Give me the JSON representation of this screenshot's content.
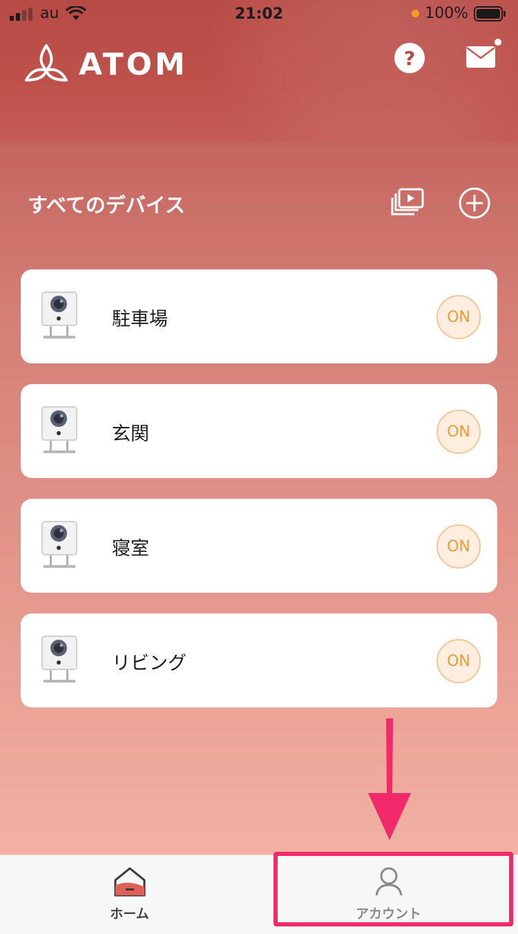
{
  "statusbar": {
    "carrier": "au",
    "time": "21:02",
    "battery": "100%",
    "icons": [
      "signal-icon",
      "wifi-icon",
      "battery-icon"
    ]
  },
  "header": {
    "logo_text": "ATOM",
    "help_label": "?",
    "icons": [
      "help-icon",
      "mail-icon"
    ]
  },
  "section": {
    "title": "すべてのデバイス",
    "icons": [
      "playlist-icon",
      "add-device-icon"
    ]
  },
  "devices": [
    {
      "name": "駐車場",
      "toggle_label": "ON"
    },
    {
      "name": "玄関",
      "toggle_label": "ON"
    },
    {
      "name": "寝室",
      "toggle_label": "ON"
    },
    {
      "name": "リビング",
      "toggle_label": "ON"
    }
  ],
  "tabbar": {
    "tabs": [
      {
        "label": "ホーム",
        "icon": "home-icon",
        "active": true
      },
      {
        "label": "アカウント",
        "icon": "account-icon",
        "active": false
      }
    ]
  },
  "annotation": {
    "arrow_color": "#f22a6a",
    "highlight_color": "#f22a6a"
  },
  "colors": {
    "brand": "#c45b55",
    "toggle_accent": "#f09a3a"
  }
}
